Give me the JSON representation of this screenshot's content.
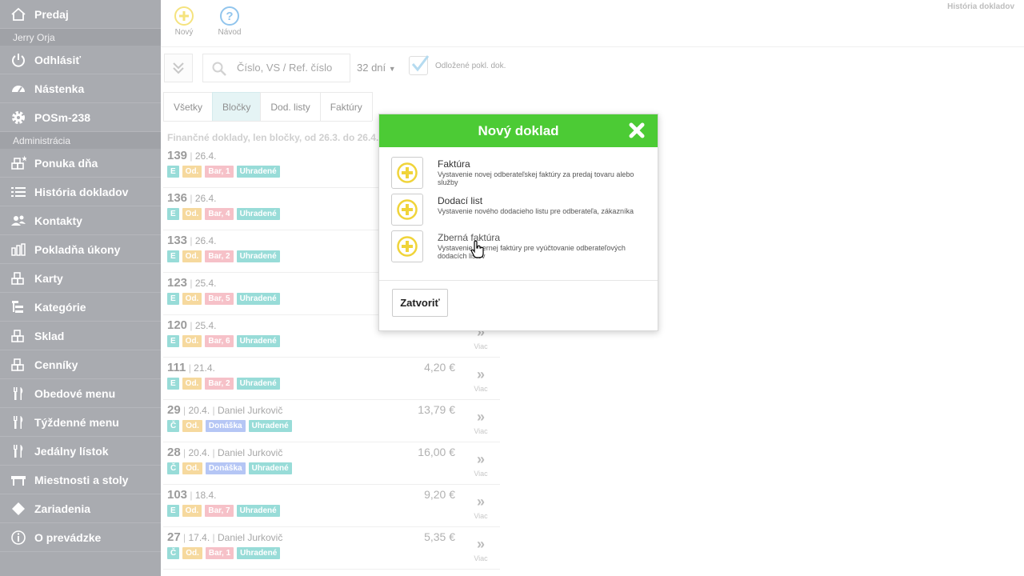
{
  "sidebar": {
    "top_item": "Predaj",
    "user_name": "Jerry Orja",
    "logout": "Odhlásiť",
    "dashboard": "Nástenka",
    "pos": "POSm-238",
    "admin_section": "Administrácia",
    "items": [
      {
        "label": "Ponuka dňa",
        "icon": "blocks-star-icon"
      },
      {
        "label": "História dokladov",
        "icon": "list-icon"
      },
      {
        "label": "Kontakty",
        "icon": "people-icon"
      },
      {
        "label": "Pokladňa úkony",
        "icon": "bars-icon"
      },
      {
        "label": "Karty",
        "icon": "blocks-icon"
      },
      {
        "label": "Kategórie",
        "icon": "tree-icon"
      },
      {
        "label": "Sklad",
        "icon": "blocks-icon"
      },
      {
        "label": "Cenníky",
        "icon": "blocks-icon"
      },
      {
        "label": "Obedové menu",
        "icon": "cutlery-icon"
      },
      {
        "label": "Týždenné menu",
        "icon": "cutlery-icon"
      },
      {
        "label": "Jedálny lístok",
        "icon": "cutlery-icon"
      },
      {
        "label": "Miestnosti a stoly",
        "icon": "table-icon"
      },
      {
        "label": "Zariadenia",
        "icon": "diamond-icon"
      },
      {
        "label": "O prevádzke",
        "icon": "info-icon"
      }
    ]
  },
  "toolbar": {
    "new_label": "Nový",
    "help_label": "Návod",
    "page_label": "História dokladov"
  },
  "filters": {
    "search_placeholder": "Číslo, VS / Ref. číslo",
    "days": "32 dní",
    "checkbox_label": "Odložené pokl. dok."
  },
  "tabs": [
    "Všetky",
    "Bločky",
    "Dod. listy",
    "Faktúry"
  ],
  "list": {
    "title": "Finančné doklady, len bločky, od 26.3. do 26.4.",
    "rows": [
      {
        "num": "139",
        "date": "26.4.",
        "name": "",
        "amount": "",
        "tags": [
          "E",
          "Od.",
          "Bar, 1",
          "Uhradené"
        ]
      },
      {
        "num": "136",
        "date": "26.4.",
        "name": "",
        "amount": "",
        "tags": [
          "E",
          "Od.",
          "Bar, 4",
          "Uhradené"
        ]
      },
      {
        "num": "133",
        "date": "26.4.",
        "name": "",
        "amount": "",
        "tags": [
          "E",
          "Od.",
          "Bar, 2",
          "Uhradené"
        ]
      },
      {
        "num": "123",
        "date": "25.4.",
        "name": "",
        "amount": "",
        "tags": [
          "E",
          "Od.",
          "Bar, 5",
          "Uhradené"
        ]
      },
      {
        "num": "120",
        "date": "25.4.",
        "name": "",
        "amount": "",
        "tags": [
          "E",
          "Od.",
          "Bar, 6",
          "Uhradené"
        ]
      },
      {
        "num": "111",
        "date": "21.4.",
        "name": "",
        "amount": "4,20 €",
        "tags": [
          "E",
          "Od.",
          "Bar, 2",
          "Uhradené"
        ]
      },
      {
        "num": "29",
        "date": "20.4.",
        "name": "Daniel Jurkovič",
        "amount": "13,79 €",
        "tags": [
          "Č",
          "Od.",
          "Donáška",
          "Uhradené"
        ]
      },
      {
        "num": "28",
        "date": "20.4.",
        "name": "Daniel Jurkovič",
        "amount": "16,00 €",
        "tags": [
          "Č",
          "Od.",
          "Donáška",
          "Uhradené"
        ]
      },
      {
        "num": "103",
        "date": "18.4.",
        "name": "",
        "amount": "9,20 €",
        "tags": [
          "E",
          "Od.",
          "Bar, 7",
          "Uhradené"
        ]
      },
      {
        "num": "27",
        "date": "17.4.",
        "name": "Daniel Jurkovič",
        "amount": "5,35 €",
        "tags": [
          "Č",
          "Od.",
          "Bar, 1",
          "Uhradené"
        ]
      }
    ],
    "more_label": "Viac"
  },
  "modal": {
    "title": "Nový doklad",
    "options": [
      {
        "title": "Faktúra",
        "desc": "Vystavenie novej odberateľskej faktúry za predaj tovaru alebo služby"
      },
      {
        "title": "Dodací list",
        "desc": "Vystavenie nového dodacieho listu pre odberateľa, zákazníka"
      },
      {
        "title": "Zberná faktúra",
        "desc": "Vystavenie zbernej faktúry pre vyúčtovanie odberateľových dodacích listov"
      }
    ],
    "close_label": "Zatvoriť"
  },
  "colors": {
    "sidebar": "#7c7e86",
    "modal_header": "#4ccb35",
    "tag_type": "#62c9c3",
    "tag_od": "#f2c56b",
    "tag_bar": "#f2a0ab",
    "tag_donaska": "#8ea8f0",
    "tag_paid": "#62c9c3",
    "accent_yellow": "#f0d43a",
    "accent_blue": "#57a6e3"
  }
}
